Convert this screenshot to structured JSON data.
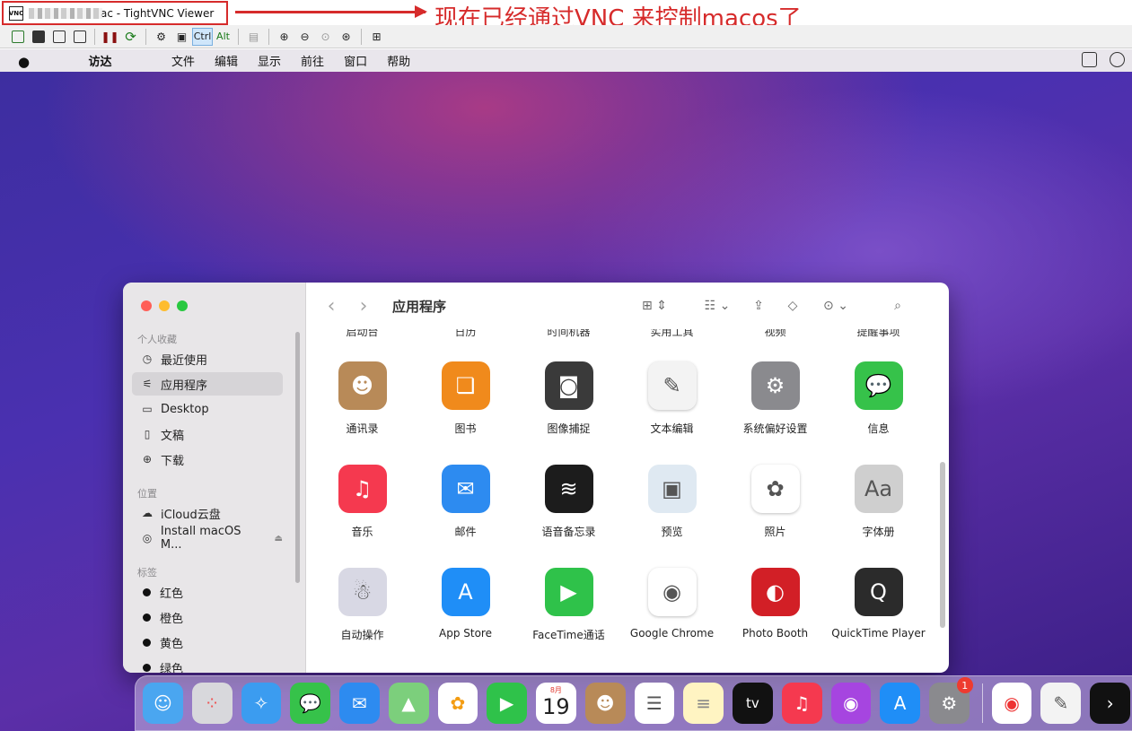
{
  "vnc": {
    "title": "ac - TightVNC Viewer",
    "logo_text": "VNC",
    "annotation": "现在已经通过VNC 来控制macos了",
    "toolbar_ctrl": "Ctrl",
    "toolbar_alt": "Alt"
  },
  "menubar": {
    "items": [
      "访达",
      "文件",
      "编辑",
      "显示",
      "前往",
      "窗口",
      "帮助"
    ]
  },
  "finder": {
    "title": "应用程序",
    "sections": {
      "favorites": "个人收藏",
      "locations": "位置",
      "tags": "标签"
    },
    "favorites": [
      "最近使用",
      "应用程序",
      "Desktop",
      "文稿",
      "下载"
    ],
    "locations": [
      "iCloud云盘",
      "Install macOS M..."
    ],
    "tags": [
      "红色",
      "橙色",
      "黄色",
      "绿色"
    ],
    "partial_row": [
      "启动台",
      "日历",
      "时间机器",
      "实用工具",
      "视频",
      "提醒事项"
    ],
    "apps": [
      {
        "label": "通讯录",
        "icon": "contacts-icon",
        "color": "#b88a58"
      },
      {
        "label": "图书",
        "icon": "books-icon",
        "color": "#f08a1c"
      },
      {
        "label": "图像捕捉",
        "icon": "image-capture-icon",
        "color": "#3a3a3a"
      },
      {
        "label": "文本编辑",
        "icon": "textedit-icon",
        "color": "#f3f3f3"
      },
      {
        "label": "系统偏好设置",
        "icon": "system-preferences-icon",
        "color": "#8a8a8e"
      },
      {
        "label": "信息",
        "icon": "messages-icon",
        "color": "#36c24a"
      },
      {
        "label": "音乐",
        "icon": "music-icon",
        "color": "#f5394f"
      },
      {
        "label": "邮件",
        "icon": "mail-icon",
        "color": "#2d8bf0"
      },
      {
        "label": "语音备忘录",
        "icon": "voice-memos-icon",
        "color": "#1c1c1c"
      },
      {
        "label": "预览",
        "icon": "preview-icon",
        "color": "#dfe9f2"
      },
      {
        "label": "照片",
        "icon": "photos-icon",
        "color": "#ffffff"
      },
      {
        "label": "字体册",
        "icon": "font-book-icon",
        "color": "#cfcfcf"
      },
      {
        "label": "自动操作",
        "icon": "automator-icon",
        "color": "#d8d8e4"
      },
      {
        "label": "App Store",
        "icon": "app-store-icon",
        "color": "#1f8ef7"
      },
      {
        "label": "FaceTime通话",
        "icon": "facetime-icon",
        "color": "#2fc24a"
      },
      {
        "label": "Google Chrome",
        "icon": "chrome-icon",
        "color": "#ffffff"
      },
      {
        "label": "Photo Booth",
        "icon": "photo-booth-icon",
        "color": "#d21f26"
      },
      {
        "label": "QuickTime Player",
        "icon": "quicktime-icon",
        "color": "#2b2b2b"
      }
    ]
  },
  "dock": {
    "calendar_month": "8月",
    "calendar_day": "19",
    "system_prefs_badge": "1",
    "appletv_label": "tv"
  }
}
